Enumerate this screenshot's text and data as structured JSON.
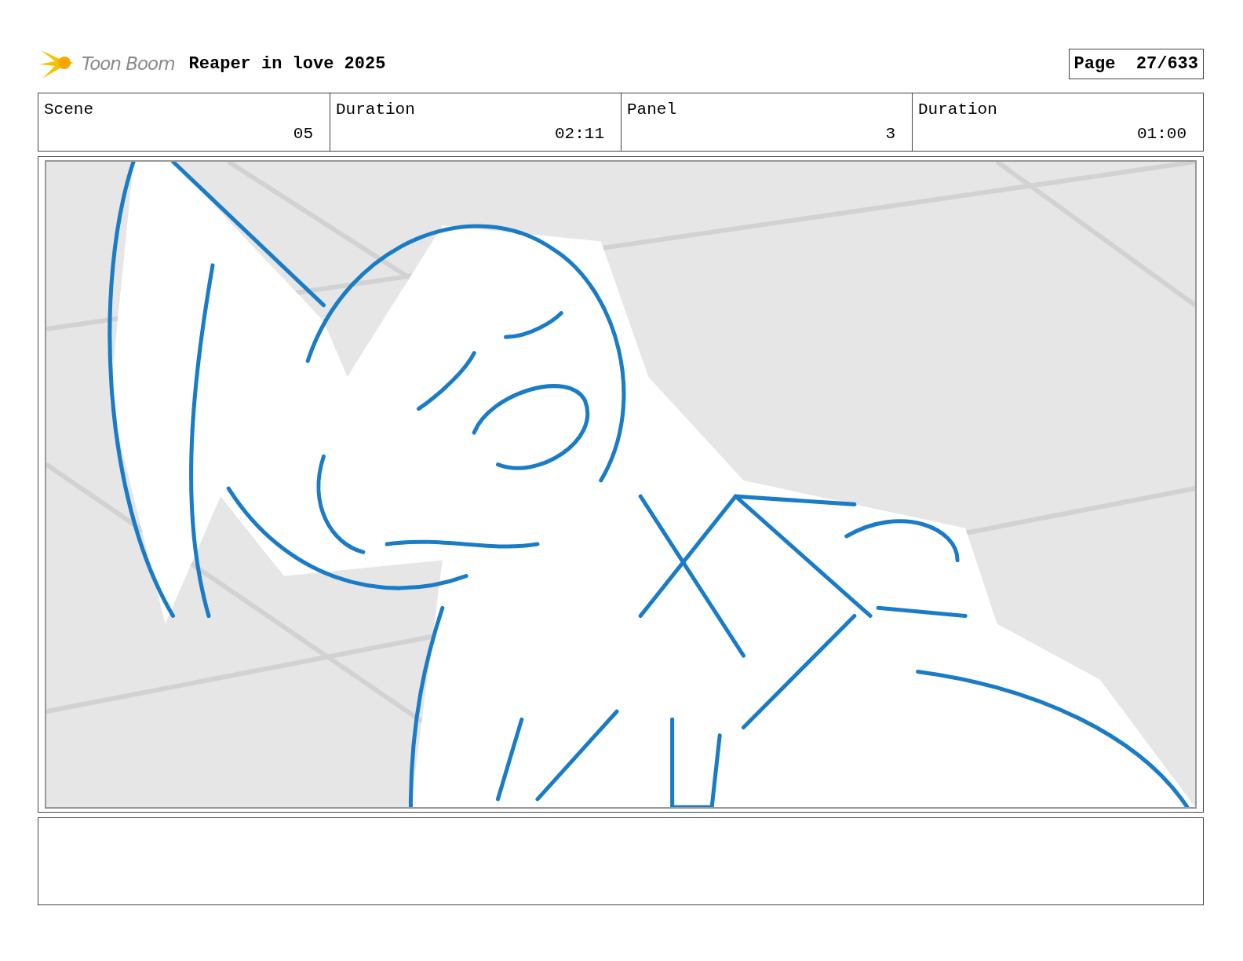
{
  "header": {
    "logo": "Toon Boom",
    "title": "Reaper in love 2025",
    "page_label": "Page",
    "page": "27/633"
  },
  "info": [
    {
      "label": "Scene",
      "value": "05"
    },
    {
      "label": "Duration",
      "value": "02:11"
    },
    {
      "label": "Panel",
      "value": "3"
    },
    {
      "label": "Duration",
      "value": "01:00"
    }
  ]
}
